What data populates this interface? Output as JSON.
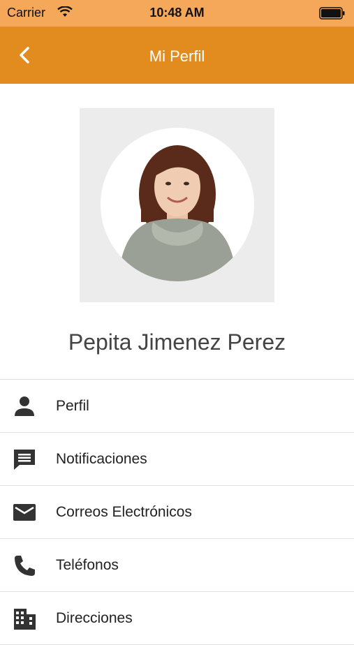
{
  "status_bar": {
    "carrier": "Carrier",
    "time": "10:48 AM"
  },
  "nav": {
    "title": "Mi Perfil",
    "back_icon": "chevron-left-icon",
    "background_color": "#e28c1f"
  },
  "profile": {
    "name": "Pepita Jimenez Perez",
    "avatar": "profile-photo"
  },
  "menu": {
    "items": [
      {
        "label": "Perfil",
        "icon": "person-icon"
      },
      {
        "label": "Notificaciones",
        "icon": "chat-icon"
      },
      {
        "label": "Correos Electrónicos",
        "icon": "mail-icon"
      },
      {
        "label": "Teléfonos",
        "icon": "phone-icon"
      },
      {
        "label": "Direcciones",
        "icon": "building-icon"
      }
    ]
  },
  "colors": {
    "status_bar": "#f5a75a",
    "nav_bar": "#e28c1f",
    "icon": "#333333"
  }
}
